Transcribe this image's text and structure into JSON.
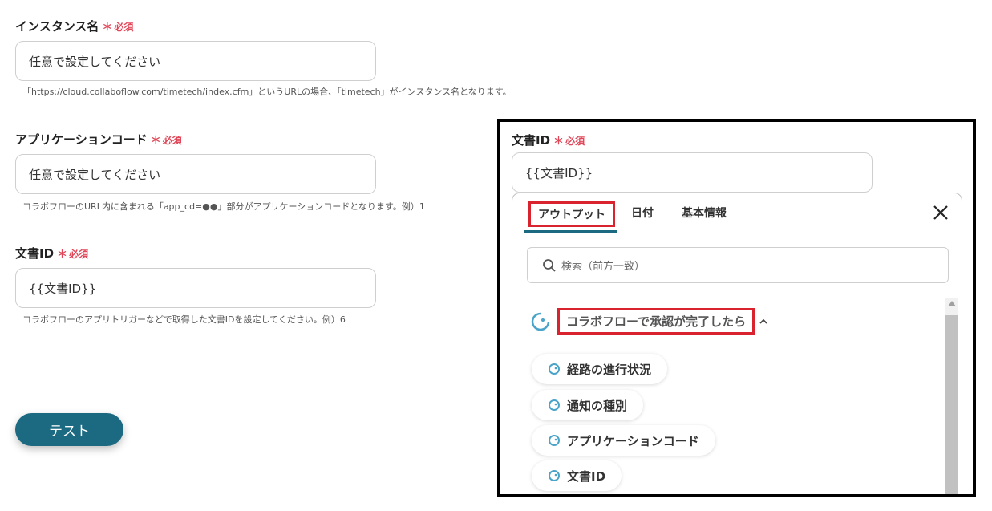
{
  "required_label": "必須",
  "fields": [
    {
      "label": "インスタンス名",
      "placeholder": "任意で設定してください",
      "help": "「https://cloud.collaboflow.com/timetech/index.cfm」というURLの場合、「timetech」がインスタンス名となります。"
    },
    {
      "label": "アプリケーションコード",
      "placeholder": "任意で設定してください",
      "help": "コラボフローのURL内に含まれる「app_cd=●●」部分がアプリケーションコードとなります。例）1"
    },
    {
      "label": "文書ID",
      "value": "{{文書ID}}",
      "help": "コラボフローのアプリトリガーなどで取得した文書IDを設定してください。例）6"
    }
  ],
  "test_button": "テスト",
  "panel": {
    "label": "文書ID",
    "value": "{{文書ID}}",
    "tabs": [
      "アウトプット",
      "日付",
      "基本情報"
    ],
    "search_placeholder": "検索（前方一致）",
    "group_title": "コラボフローで承認が完了したら",
    "items": [
      "経路の進行状況",
      "通知の種別",
      "アプリケーションコード",
      "文書ID"
    ]
  },
  "colors": {
    "accent": "#1c6a82",
    "required": "#e0485a",
    "highlight": "#d9232e",
    "icon": "#4aa3c8"
  }
}
